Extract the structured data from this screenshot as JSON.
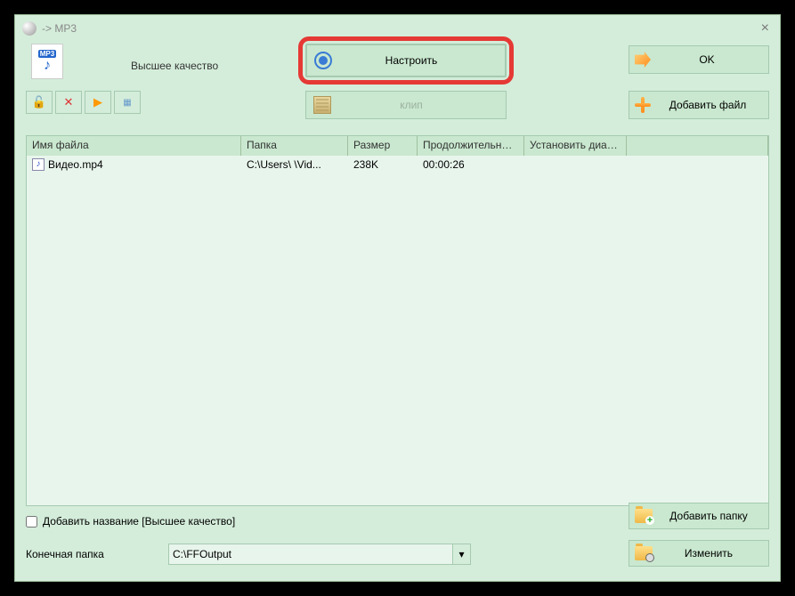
{
  "window": {
    "title": "-> MP3"
  },
  "header": {
    "quality": "Высшее качество",
    "configure": "Настроить",
    "ok": "OK",
    "add_file": "Добавить файл",
    "clip": "клип"
  },
  "table": {
    "columns": {
      "name": "Имя файла",
      "folder": "Папка",
      "size": "Размер",
      "duration": "Продолжительность",
      "range": "Установить диапа..."
    },
    "rows": [
      {
        "name": "Видео.mp4",
        "folder": "C:\\Users\\         \\Vid...",
        "size": "238K",
        "duration": "00:00:26",
        "range": ""
      }
    ]
  },
  "footer": {
    "add_name_label": "Добавить название [Высшее качество]",
    "output_label": "Конечная папка",
    "output_path": "C:\\FFOutput",
    "add_folder": "Добавить папку",
    "change": "Изменить"
  }
}
